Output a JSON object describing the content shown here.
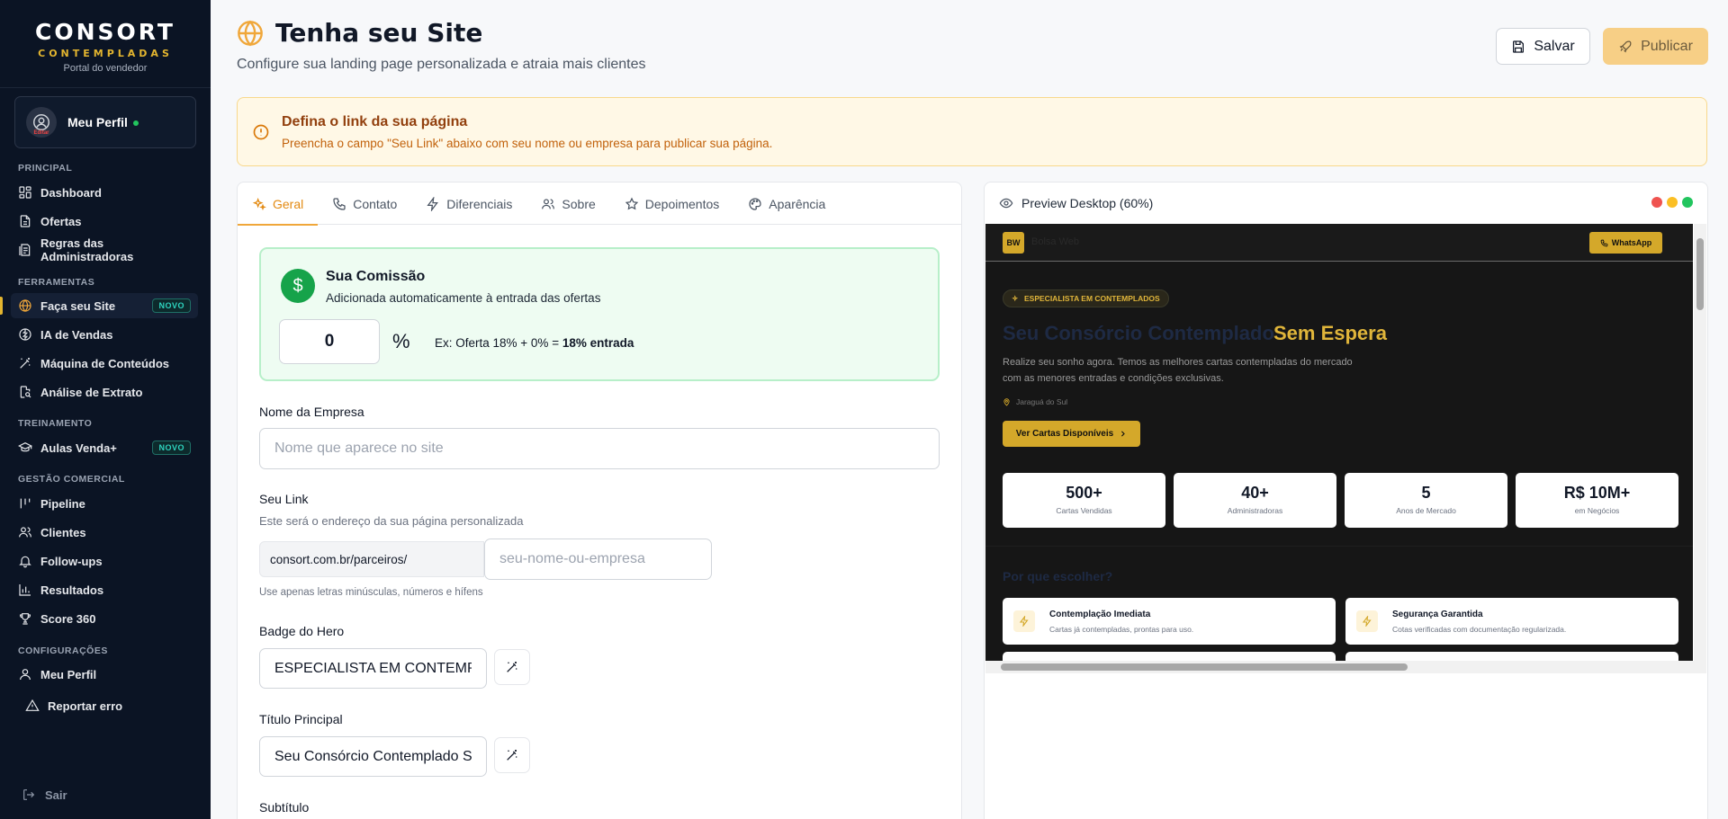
{
  "brand": {
    "name": "CONSORT",
    "sub": "CONTEMPLADAS",
    "tagline": "Portal do vendedor"
  },
  "profile": {
    "name": "Meu Perfil",
    "edit_tag": "Editar"
  },
  "sidebar": {
    "sections": [
      {
        "title": "PRINCIPAL"
      },
      {
        "title": "FERRAMENTAS"
      },
      {
        "title": "TREINAMENTO"
      },
      {
        "title": "GESTÃO COMERCIAL"
      },
      {
        "title": "CONFIGURAÇÕES"
      }
    ],
    "items": [
      {
        "label": "Dashboard",
        "icon": "dashboard-icon"
      },
      {
        "label": "Ofertas",
        "icon": "document-icon"
      },
      {
        "label": "Regras das Administradoras",
        "icon": "rules-icon"
      },
      {
        "label": "Faça seu Site",
        "icon": "globe-icon",
        "badge": "NOVO",
        "active": true
      },
      {
        "label": "IA de Vendas",
        "icon": "brain-icon"
      },
      {
        "label": "Máquina de Conteúdos",
        "icon": "magic-wand-icon"
      },
      {
        "label": "Análise de Extrato",
        "icon": "file-search-icon"
      },
      {
        "label": "Aulas Venda+",
        "icon": "graduation-cap-icon",
        "badge": "NOVO"
      },
      {
        "label": "Pipeline",
        "icon": "pipeline-icon"
      },
      {
        "label": "Clientes",
        "icon": "users-icon"
      },
      {
        "label": "Follow-ups",
        "icon": "bell-icon"
      },
      {
        "label": "Resultados",
        "icon": "bar-chart-icon"
      },
      {
        "label": "Score 360",
        "icon": "trophy-icon"
      },
      {
        "label": "Meu Perfil",
        "icon": "user-icon"
      },
      {
        "label": "Reportar erro",
        "icon": "warning-icon"
      }
    ],
    "logout": "Sair"
  },
  "header": {
    "title": "Tenha seu Site",
    "subtitle": "Configure sua landing page personalizada e atraia mais clientes",
    "save_label": "Salvar",
    "publish_label": "Publicar"
  },
  "alert": {
    "title": "Defina o link da sua página",
    "text": "Preencha o campo \"Seu Link\" abaixo com seu nome ou empresa para publicar sua página."
  },
  "tabs": [
    {
      "label": "Geral",
      "icon": "sparkles-icon",
      "active": true
    },
    {
      "label": "Contato",
      "icon": "phone-icon"
    },
    {
      "label": "Diferenciais",
      "icon": "lightning-icon"
    },
    {
      "label": "Sobre",
      "icon": "users-icon"
    },
    {
      "label": "Depoimentos",
      "icon": "star-icon"
    },
    {
      "label": "Aparência",
      "icon": "palette-icon"
    }
  ],
  "commission": {
    "title": "Sua Comissão",
    "description": "Adicionada automaticamente à entrada das ofertas",
    "value": "0",
    "percent": "%",
    "example_prefix": "Ex: Oferta 18% + 0% = ",
    "example_bold": "18% entrada"
  },
  "form": {
    "company_label": "Nome da Empresa",
    "company_placeholder": "Nome que aparece no site",
    "link_label": "Seu Link",
    "link_hint": "Este será o endereço da sua página personalizada",
    "link_prefix": "consort.com.br/parceiros/",
    "link_placeholder": "seu-nome-ou-empresa",
    "link_note": "Use apenas letras minúsculas, números e hífens",
    "badge_label": "Badge do Hero",
    "badge_value": "ESPECIALISTA EM CONTEMPLADOS",
    "title_label": "Título Principal",
    "title_value": "Seu Consórcio Contemplado Sem Espera",
    "subtitle_label": "Subtítulo"
  },
  "preview": {
    "header": "Preview Desktop (60%)",
    "dot_colors": [
      "#ef5350",
      "#fbbf24",
      "#22c55e"
    ],
    "logo": "BW",
    "logo_text": "Bolsa Web",
    "whatsapp": "WhatsApp",
    "badge": "ESPECIALISTA EM CONTEMPLADOS",
    "hero_title": "Seu Consórcio Contemplado",
    "hero_accent": "Sem Espera",
    "hero_sub": "Realize seu sonho agora. Temos as melhores cartas contempladas do mercado com as menores entradas e condições exclusivas.",
    "location": "Jaraguá do Sul",
    "cta": "Ver Cartas Disponíveis",
    "stats": [
      {
        "value": "500+",
        "label": "Cartas Vendidas"
      },
      {
        "value": "40+",
        "label": "Administradoras"
      },
      {
        "value": "5",
        "label": "Anos de Mercado"
      },
      {
        "value": "R$ 10M+",
        "label": "em Negócios"
      }
    ],
    "why_title": "Por que escolher?",
    "features": [
      {
        "title": "Contemplação Imediata",
        "desc": "Cartas já contempladas, prontas para uso."
      },
      {
        "title": "Segurança Garantida",
        "desc": "Cotas verificadas com documentação regularizada."
      }
    ]
  }
}
